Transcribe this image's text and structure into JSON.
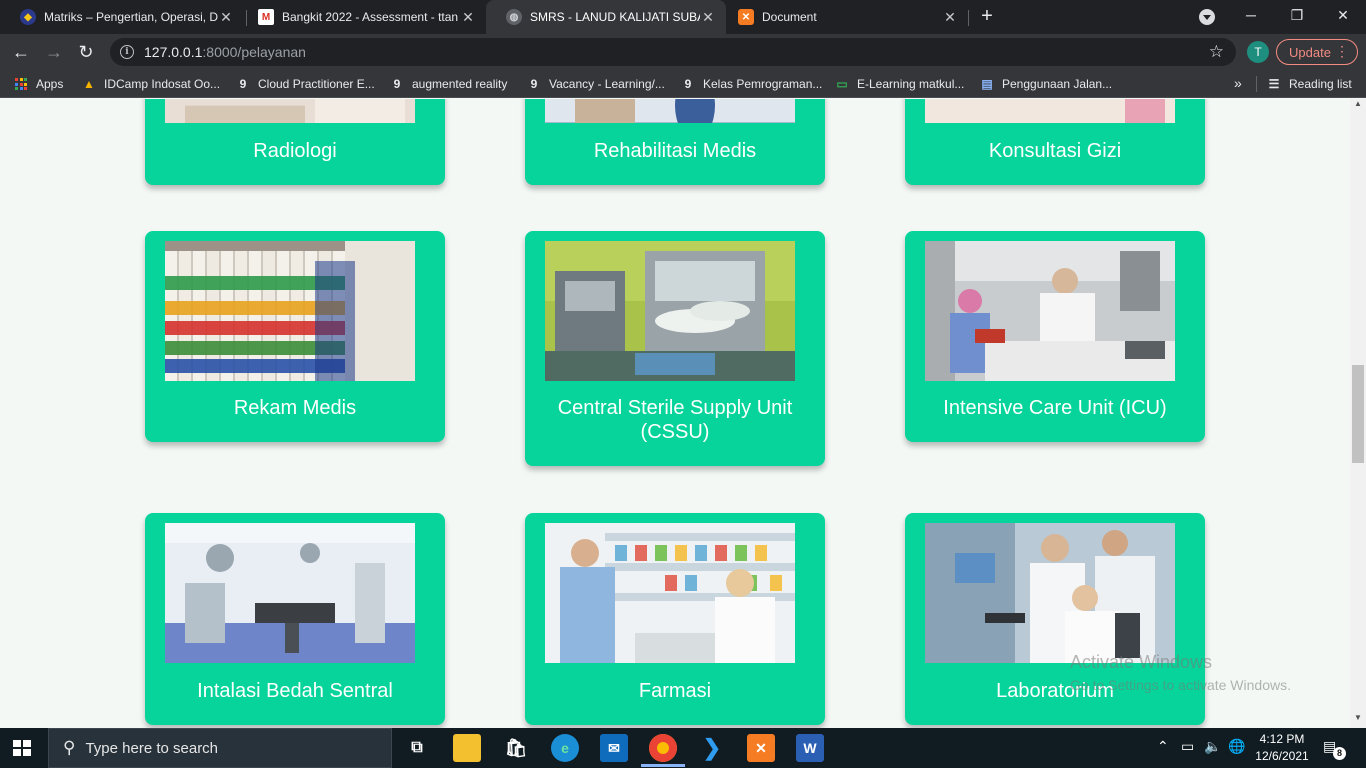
{
  "browser": {
    "tabs": [
      {
        "title": "Matriks – Pengertian, Operasi, De",
        "active": false,
        "icon": "dicoding-favicon-icon"
      },
      {
        "title": "Bangkit 2022 - Assessment - ttan",
        "active": false,
        "icon": "gmail-icon"
      },
      {
        "title": "SMRS - LANUD KALIJATI SUBANG",
        "active": true,
        "icon": "globe-icon"
      },
      {
        "title": "Document",
        "active": false,
        "icon": "xampp-icon"
      }
    ],
    "close_glyph": "✕",
    "newtab_glyph": "+",
    "url_host": "127.0.0.1",
    "url_path": ":8000/pelayanan",
    "profile_initial": "T",
    "update_label": "Update",
    "bookmarks": [
      {
        "label": "Apps",
        "icon": "apps-grid-icon"
      },
      {
        "label": "IDCamp Indosat Oo...",
        "icon": "idcamp-icon"
      },
      {
        "label": "Cloud Practitioner E...",
        "icon": "dicoding-icon"
      },
      {
        "label": "augmented reality",
        "icon": "dicoding-icon"
      },
      {
        "label": "Vacancy - Learning/...",
        "icon": "dicoding-icon"
      },
      {
        "label": "Kelas Pemrograman...",
        "icon": "dicoding-icon"
      },
      {
        "label": "E-Learning matkul...",
        "icon": "elearning-icon"
      },
      {
        "label": "Penggunaan Jalan...",
        "icon": "document-icon"
      }
    ],
    "reading_list_label": "Reading list"
  },
  "services": [
    {
      "label": "Radiologi"
    },
    {
      "label": "Rehabilitasi Medis"
    },
    {
      "label": "Konsultasi Gizi"
    },
    {
      "label": "Rekam Medis"
    },
    {
      "label": "Central Sterile Supply Unit (CSSU)"
    },
    {
      "label": "Intensive Care Unit (ICU)"
    },
    {
      "label": "Intalasi Bedah Sentral"
    },
    {
      "label": "Farmasi"
    },
    {
      "label": "Laboratorium"
    }
  ],
  "watermark": {
    "line1": "Activate Windows",
    "line2": "Go to Settings to activate Windows."
  },
  "taskbar": {
    "search_placeholder": "Type here to search",
    "time": "4:12 PM",
    "date": "12/6/2021",
    "notification_count": "8"
  },
  "colors": {
    "card": "#06d49a",
    "page_bg": "#f3f8f5",
    "chrome_dark": "#202124",
    "chrome_toolbar": "#35363a"
  }
}
